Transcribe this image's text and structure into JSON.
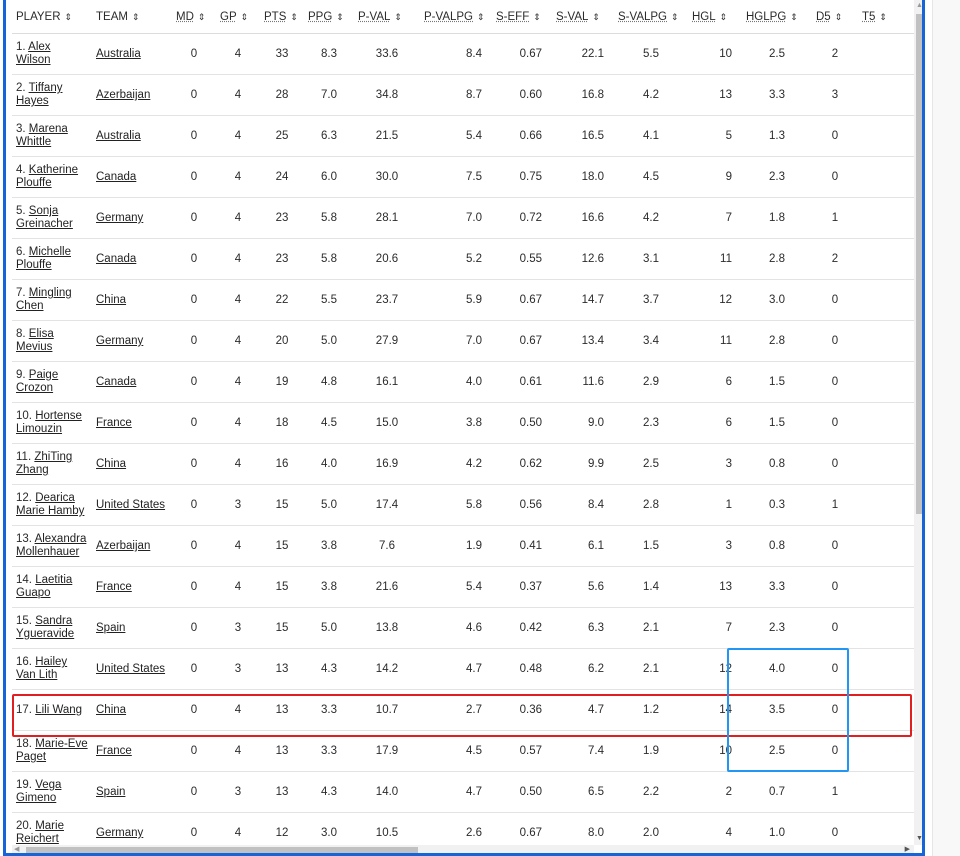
{
  "columns": [
    {
      "label": "PLAYER",
      "sort": "⇕"
    },
    {
      "label": "TEAM",
      "sort": "⇕"
    },
    {
      "label": "MD",
      "sort": "⇕"
    },
    {
      "label": "GP",
      "sort": "⇕"
    },
    {
      "label": "PTS",
      "sort": "⇕"
    },
    {
      "label": "PPG",
      "sort": "⇕"
    },
    {
      "label": "P-VAL",
      "sort": "⇕"
    },
    {
      "label": "P-VALPG",
      "sort": "⇕"
    },
    {
      "label": "S-EFF",
      "sort": "⇕"
    },
    {
      "label": "S-VAL",
      "sort": "⇕"
    },
    {
      "label": "S-VALPG",
      "sort": "⇕"
    },
    {
      "label": "HGL",
      "sort": "⇕"
    },
    {
      "label": "HGLPG",
      "sort": "⇕"
    },
    {
      "label": "D5",
      "sort": "⇕"
    },
    {
      "label": "T5",
      "sort": "⇕"
    }
  ],
  "rows": [
    {
      "rank": "1.",
      "name": "Alex Wilson",
      "team": "Australia",
      "md": "0",
      "gp": "4",
      "pts": "33",
      "ppg": "8.3",
      "pval": "33.6",
      "pvalpg": "8.4",
      "seff": "0.67",
      "sval": "22.1",
      "svalpg": "5.5",
      "hgl": "10",
      "hglpg": "2.5",
      "d5": "2"
    },
    {
      "rank": "2.",
      "name": "Tiffany Hayes",
      "team": "Azerbaijan",
      "md": "0",
      "gp": "4",
      "pts": "28",
      "ppg": "7.0",
      "pval": "34.8",
      "pvalpg": "8.7",
      "seff": "0.60",
      "sval": "16.8",
      "svalpg": "4.2",
      "hgl": "13",
      "hglpg": "3.3",
      "d5": "3"
    },
    {
      "rank": "3.",
      "name": "Marena Whittle",
      "team": "Australia",
      "md": "0",
      "gp": "4",
      "pts": "25",
      "ppg": "6.3",
      "pval": "21.5",
      "pvalpg": "5.4",
      "seff": "0.66",
      "sval": "16.5",
      "svalpg": "4.1",
      "hgl": "5",
      "hglpg": "1.3",
      "d5": "0"
    },
    {
      "rank": "4.",
      "name": "Katherine Plouffe",
      "team": "Canada",
      "md": "0",
      "gp": "4",
      "pts": "24",
      "ppg": "6.0",
      "pval": "30.0",
      "pvalpg": "7.5",
      "seff": "0.75",
      "sval": "18.0",
      "svalpg": "4.5",
      "hgl": "9",
      "hglpg": "2.3",
      "d5": "0"
    },
    {
      "rank": "5.",
      "name": "Sonja Greinacher",
      "team": "Germany",
      "md": "0",
      "gp": "4",
      "pts": "23",
      "ppg": "5.8",
      "pval": "28.1",
      "pvalpg": "7.0",
      "seff": "0.72",
      "sval": "16.6",
      "svalpg": "4.2",
      "hgl": "7",
      "hglpg": "1.8",
      "d5": "1"
    },
    {
      "rank": "6.",
      "name": "Michelle Plouffe",
      "team": "Canada",
      "md": "0",
      "gp": "4",
      "pts": "23",
      "ppg": "5.8",
      "pval": "20.6",
      "pvalpg": "5.2",
      "seff": "0.55",
      "sval": "12.6",
      "svalpg": "3.1",
      "hgl": "11",
      "hglpg": "2.8",
      "d5": "2"
    },
    {
      "rank": "7.",
      "name": "Mingling Chen",
      "team": "China",
      "md": "0",
      "gp": "4",
      "pts": "22",
      "ppg": "5.5",
      "pval": "23.7",
      "pvalpg": "5.9",
      "seff": "0.67",
      "sval": "14.7",
      "svalpg": "3.7",
      "hgl": "12",
      "hglpg": "3.0",
      "d5": "0"
    },
    {
      "rank": "8.",
      "name": "Elisa Mevius",
      "team": "Germany",
      "md": "0",
      "gp": "4",
      "pts": "20",
      "ppg": "5.0",
      "pval": "27.9",
      "pvalpg": "7.0",
      "seff": "0.67",
      "sval": "13.4",
      "svalpg": "3.4",
      "hgl": "11",
      "hglpg": "2.8",
      "d5": "0"
    },
    {
      "rank": "9.",
      "name": "Paige Crozon",
      "team": "Canada",
      "md": "0",
      "gp": "4",
      "pts": "19",
      "ppg": "4.8",
      "pval": "16.1",
      "pvalpg": "4.0",
      "seff": "0.61",
      "sval": "11.6",
      "svalpg": "2.9",
      "hgl": "6",
      "hglpg": "1.5",
      "d5": "0"
    },
    {
      "rank": "10.",
      "name": "Hortense Limouzin",
      "team": "France",
      "md": "0",
      "gp": "4",
      "pts": "18",
      "ppg": "4.5",
      "pval": "15.0",
      "pvalpg": "3.8",
      "seff": "0.50",
      "sval": "9.0",
      "svalpg": "2.3",
      "hgl": "6",
      "hglpg": "1.5",
      "d5": "0"
    },
    {
      "rank": "11.",
      "name": "ZhiTing Zhang",
      "team": "China",
      "md": "0",
      "gp": "4",
      "pts": "16",
      "ppg": "4.0",
      "pval": "16.9",
      "pvalpg": "4.2",
      "seff": "0.62",
      "sval": "9.9",
      "svalpg": "2.5",
      "hgl": "3",
      "hglpg": "0.8",
      "d5": "0"
    },
    {
      "rank": "12.",
      "name": "Dearica Marie Hamby",
      "team": "United States",
      "md": "0",
      "gp": "3",
      "pts": "15",
      "ppg": "5.0",
      "pval": "17.4",
      "pvalpg": "5.8",
      "seff": "0.56",
      "sval": "8.4",
      "svalpg": "2.8",
      "hgl": "1",
      "hglpg": "0.3",
      "d5": "1"
    },
    {
      "rank": "13.",
      "name": "Alexandra Mollenhauer",
      "team": "Azerbaijan",
      "md": "0",
      "gp": "4",
      "pts": "15",
      "ppg": "3.8",
      "pval": "7.6",
      "pvalpg": "1.9",
      "seff": "0.41",
      "sval": "6.1",
      "svalpg": "1.5",
      "hgl": "3",
      "hglpg": "0.8",
      "d5": "0"
    },
    {
      "rank": "14.",
      "name": "Laetitia Guapo",
      "team": "France",
      "md": "0",
      "gp": "4",
      "pts": "15",
      "ppg": "3.8",
      "pval": "21.6",
      "pvalpg": "5.4",
      "seff": "0.37",
      "sval": "5.6",
      "svalpg": "1.4",
      "hgl": "13",
      "hglpg": "3.3",
      "d5": "0"
    },
    {
      "rank": "15.",
      "name": "Sandra Ygueravide",
      "team": "Spain",
      "md": "0",
      "gp": "3",
      "pts": "15",
      "ppg": "5.0",
      "pval": "13.8",
      "pvalpg": "4.6",
      "seff": "0.42",
      "sval": "6.3",
      "svalpg": "2.1",
      "hgl": "7",
      "hglpg": "2.3",
      "d5": "0"
    },
    {
      "rank": "16.",
      "name": "Hailey Van Lith",
      "team": "United States",
      "md": "0",
      "gp": "3",
      "pts": "13",
      "ppg": "4.3",
      "pval": "14.2",
      "pvalpg": "4.7",
      "seff": "0.48",
      "sval": "6.2",
      "svalpg": "2.1",
      "hgl": "12",
      "hglpg": "4.0",
      "d5": "0"
    },
    {
      "rank": "17.",
      "name": "Lili Wang",
      "team": "China",
      "md": "0",
      "gp": "4",
      "pts": "13",
      "ppg": "3.3",
      "pval": "10.7",
      "pvalpg": "2.7",
      "seff": "0.36",
      "sval": "4.7",
      "svalpg": "1.2",
      "hgl": "14",
      "hglpg": "3.5",
      "d5": "0"
    },
    {
      "rank": "18.",
      "name": "Marie-Eve Paget",
      "team": "France",
      "md": "0",
      "gp": "4",
      "pts": "13",
      "ppg": "3.3",
      "pval": "17.9",
      "pvalpg": "4.5",
      "seff": "0.57",
      "sval": "7.4",
      "svalpg": "1.9",
      "hgl": "10",
      "hglpg": "2.5",
      "d5": "0"
    },
    {
      "rank": "19.",
      "name": "Vega Gimeno",
      "team": "Spain",
      "md": "0",
      "gp": "3",
      "pts": "13",
      "ppg": "4.3",
      "pval": "14.0",
      "pvalpg": "4.7",
      "seff": "0.50",
      "sval": "6.5",
      "svalpg": "2.2",
      "hgl": "2",
      "hglpg": "0.7",
      "d5": "1"
    },
    {
      "rank": "20.",
      "name": "Marie Reichert",
      "team": "Germany",
      "md": "0",
      "gp": "4",
      "pts": "12",
      "ppg": "3.0",
      "pval": "10.5",
      "pvalpg": "2.6",
      "seff": "0.67",
      "sval": "8.0",
      "svalpg": "2.0",
      "hgl": "4",
      "hglpg": "1.0",
      "d5": "0"
    }
  ],
  "scrollbar": {
    "up": "▲",
    "down": "▼",
    "left": "◀",
    "right": "▶"
  },
  "colors": {
    "frame": "#1565d8",
    "highlight_row": "#e02020",
    "highlight_cols": "#2196f3"
  }
}
